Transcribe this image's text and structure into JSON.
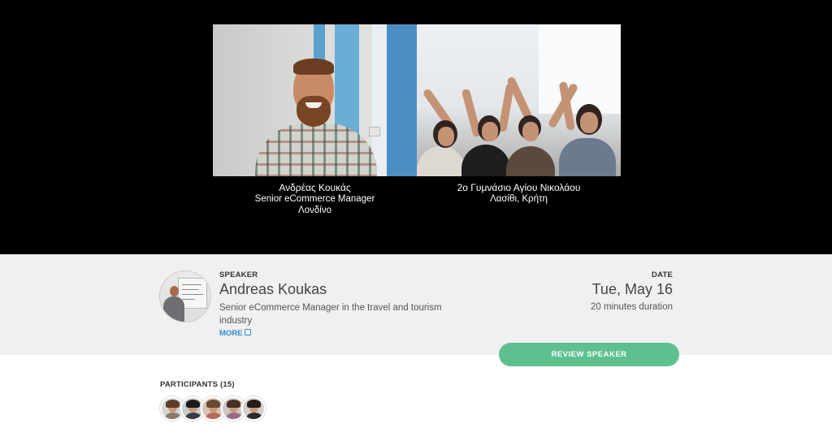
{
  "video": {
    "left": {
      "name": "Ανδρέας Κουκάς",
      "role": "Senior eCommerce Manager",
      "location": "Λονδίνο"
    },
    "right": {
      "name": "2ο Γυμνάσιο Αγίου Νικολάου",
      "location": "Λασίθι, Κρήτη"
    }
  },
  "speaker": {
    "label": "SPEAKER",
    "name": "Andreas Koukas",
    "description": "Senior eCommerce Manager in the travel and tourism industry",
    "more_label": "MORE"
  },
  "date": {
    "label": "DATE",
    "value": "Tue, May 16",
    "duration": "20 minutes duration"
  },
  "review_button": "REVIEW SPEAKER",
  "participants": {
    "label": "PARTICIPANTS (15)"
  },
  "colors": {
    "accent_green": "#5fc08f",
    "link_blue": "#2f8ed6",
    "video_bg": "#000000",
    "band_bg": "#eef0f1"
  }
}
